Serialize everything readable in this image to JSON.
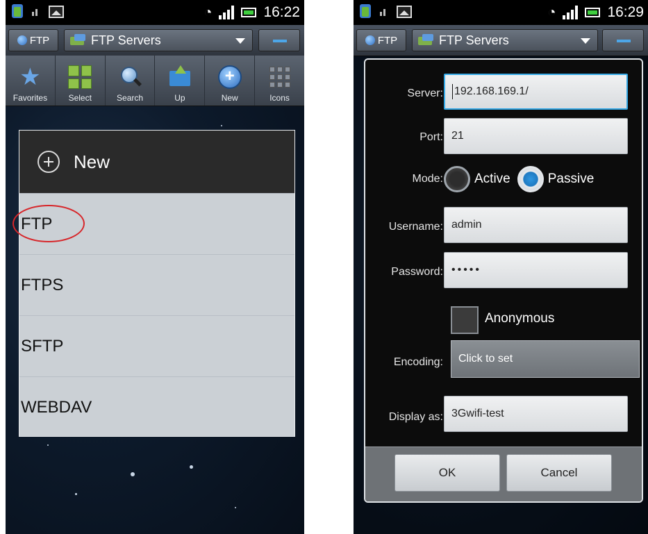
{
  "left": {
    "status": {
      "time": "16:22"
    },
    "titlebar": {
      "ftp_label": "FTP",
      "servers_label": "FTP Servers"
    },
    "toolbar": [
      "Favorites",
      "Select",
      "Search",
      "Up",
      "New",
      "Icons"
    ],
    "dialog": {
      "title": "New",
      "items": [
        "FTP",
        "FTPS",
        "SFTP",
        "WEBDAV"
      ]
    }
  },
  "right": {
    "status": {
      "time": "16:29"
    },
    "titlebar": {
      "ftp_label": "FTP",
      "servers_label": "FTP Servers"
    },
    "form": {
      "server_label": "Server:",
      "server_value": "192.168.169.1/",
      "port_label": "Port:",
      "port_value": "21",
      "mode_label": "Mode:",
      "mode_active": "Active",
      "mode_passive": "Passive",
      "mode_selected": "Passive",
      "username_label": "Username:",
      "username_value": "admin",
      "password_label": "Password:",
      "password_value": "•••••",
      "anonymous_label": "Anonymous",
      "anonymous_checked": false,
      "encoding_label": "Encoding:",
      "encoding_value": "Click to set",
      "display_label": "Display as:",
      "display_value": "3Gwifi-test"
    },
    "buttons": {
      "ok": "OK",
      "cancel": "Cancel"
    }
  },
  "colors": {
    "accent": "#35a9e6",
    "annotation": "#d7262a",
    "dialog_bg": "#cbd0d5"
  }
}
